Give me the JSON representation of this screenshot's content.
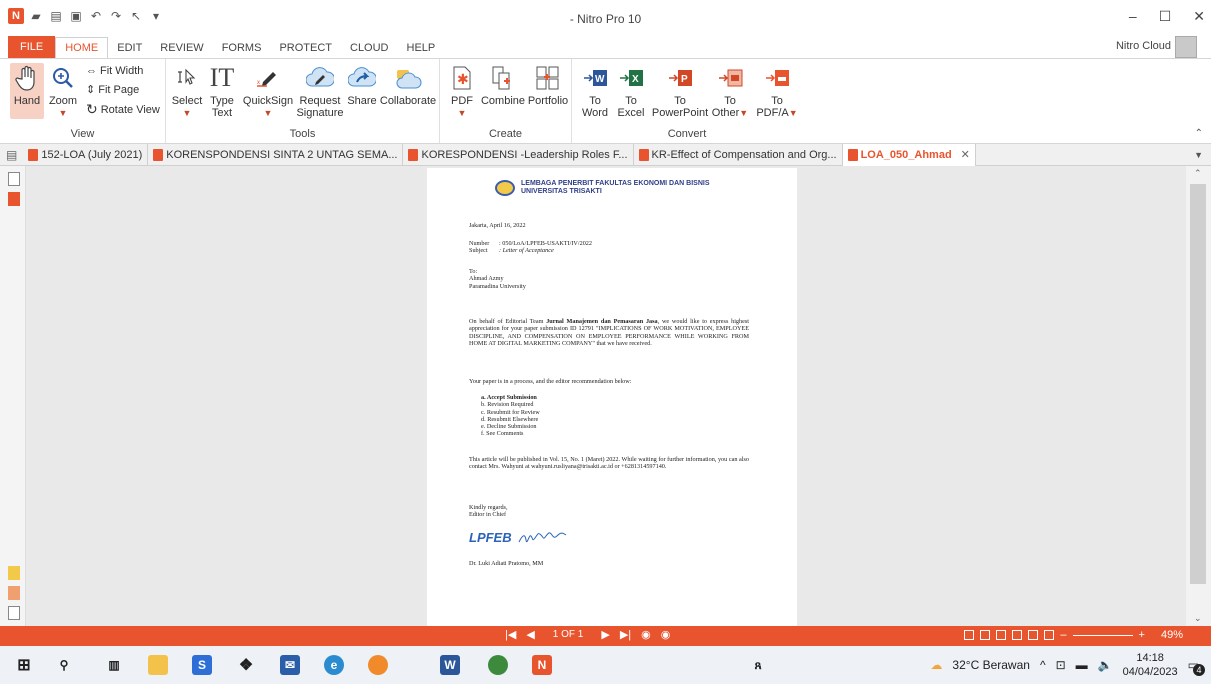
{
  "window": {
    "title": "- Nitro Pro 10"
  },
  "menu": [
    "FILE",
    "HOME",
    "EDIT",
    "REVIEW",
    "FORMS",
    "PROTECT",
    "CLOUD",
    "HELP"
  ],
  "account": {
    "label": "Nitro Cloud"
  },
  "ribbon": {
    "view": {
      "label": "View",
      "hand": "Hand",
      "zoom": "Zoom",
      "fit_width": "Fit Width",
      "fit_page": "Fit Page",
      "rotate": "Rotate View"
    },
    "tools": {
      "label": "Tools",
      "select": "Select",
      "type_text_1": "Type",
      "type_text_2": "Text",
      "quicksign": "QuickSign",
      "request_1": "Request",
      "request_2": "Signature",
      "share": "Share",
      "collaborate": "Collaborate"
    },
    "create": {
      "label": "Create",
      "pdf": "PDF",
      "combine": "Combine",
      "portfolio": "Portfolio"
    },
    "convert": {
      "label": "Convert",
      "to": "To",
      "word": "Word",
      "excel": "Excel",
      "powerpoint": "PowerPoint",
      "other": "Other",
      "pdfa": "PDF/A"
    }
  },
  "tabs": [
    "152-LOA (July 2021)",
    "KORENSPONDENSI SINTA 2 UNTAG SEMA...",
    "KORESPONDENSI -Leadership Roles F...",
    "KR-Effect of Compensation and Org...",
    "LOA_050_Ahmad"
  ],
  "document": {
    "header_1": "LEMBAGA PENERBIT FAKULTAS EKONOMI DAN BISNIS",
    "header_2": "UNIVERSITAS TRISAKTI",
    "date": "Jakarta, April 16, 2022",
    "number_label": "Number",
    "number_value": ": 050/LoA/LPFEB-USAKTI/IV/2022",
    "subject_label": "Subject",
    "subject_value": ": Letter of Acceptance",
    "to": "To:",
    "name": "Ahmad Azmy",
    "affiliation": "Paramadina University",
    "body_1_pre": "On behalf of Editorial Team ",
    "body_1_journal": "Jurnal Manajemen dan Pemasaran Jasa",
    "body_1_post": ", we would like to express highest appreciation for your paper submission ID 12791 \"IMPLICATIONS OF WORK MOTIVATION, EMPLOYEE DISCIPLINE, AND COMPENSATION ON EMPLOYEE PERFORMANCE WHILE WORKING FROM HOME AT DIGITAL MARKETING COMPANY\" that we have received.",
    "body_2": "Your paper is in a process, and the editor recommendation below:",
    "options": [
      "a.  Accept Submission",
      "b.  Revision Required",
      "c.  Resubmit for Review",
      "d.  Resubmit Elsewhere",
      "e.  Decline Submission",
      "f.  See Comments"
    ],
    "body_3": "This article will be published in Vol. 15, No. 1 (Maret) 2022. While waiting for further information, you can also contact Mrs. Wahyuni at wahyuni.rusliyana@trisakti.ac.id or +6281314597140.",
    "closing_1": "Kindly regards,",
    "closing_2": "Editor in Chief",
    "stamp": "LPFEB",
    "signatory": "Dr. Luki Adiati Pratomo, MM"
  },
  "status": {
    "page": "1 OF 1",
    "zoom": "49%"
  },
  "taskbar": {
    "weather": "32°C Berawan",
    "time": "14:18",
    "date": "04/04/2023",
    "notifications": "4"
  },
  "colors": {
    "accent": "#e8542e",
    "header_blue": "#2f3f86"
  }
}
